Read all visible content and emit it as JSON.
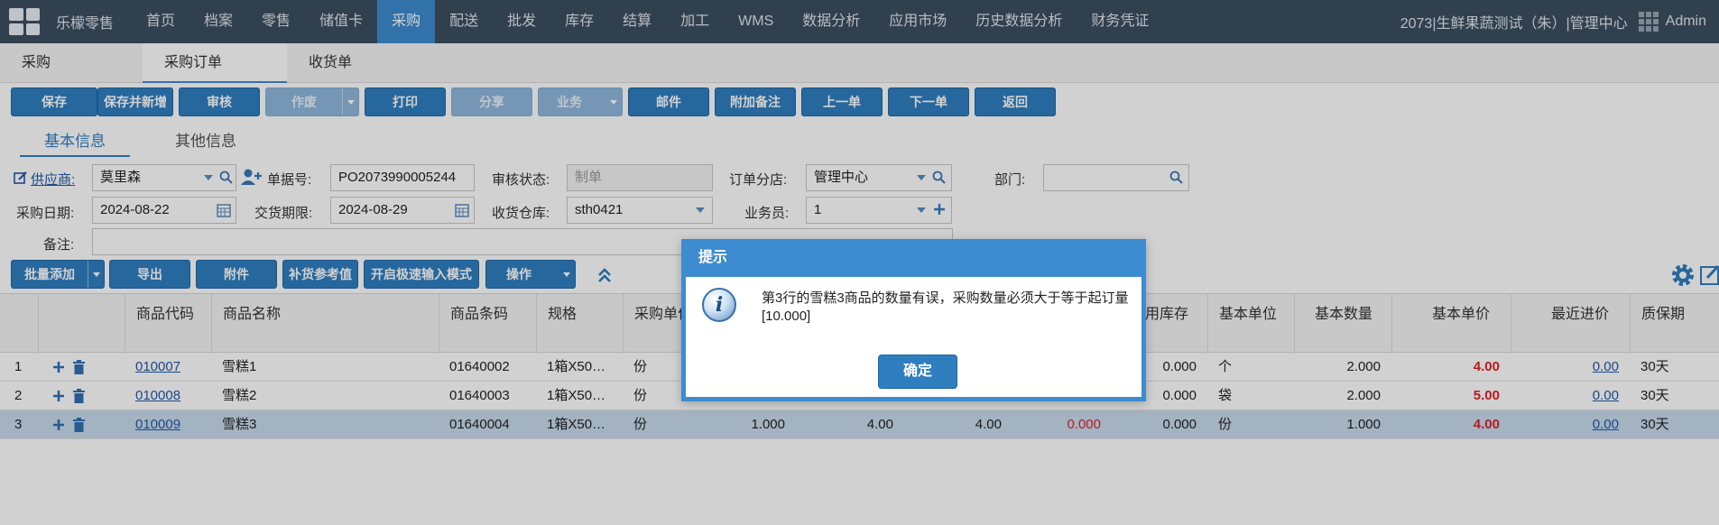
{
  "nav": {
    "brand": "乐檬零售",
    "items": [
      "首页",
      "档案",
      "零售",
      "储值卡",
      "采购",
      "配送",
      "批发",
      "库存",
      "结算",
      "加工",
      "WMS",
      "数据分析",
      "应用市场",
      "历史数据分析",
      "财务凭证"
    ],
    "active_index": 4,
    "store_info": "2073|生鲜果蔬测试（朱）|管理中心",
    "user": "Admin"
  },
  "tabs": [
    {
      "label": "采购"
    },
    {
      "label": "采购订单"
    },
    {
      "label": "收货单"
    }
  ],
  "toolbar": {
    "save": "保存",
    "save_new": "保存并新增",
    "audit": "审核",
    "void": "作废",
    "print": "打印",
    "share": "分享",
    "business": "业务",
    "mail": "邮件",
    "add_note": "附加备注",
    "prev": "上一单",
    "next": "下一单",
    "back": "返回"
  },
  "subtabs": {
    "basic": "基本信息",
    "other": "其他信息"
  },
  "form": {
    "supplier_label": "供应商:",
    "supplier": "莫里森",
    "doc_no_label": "单据号:",
    "doc_no": "PO2073990005244",
    "audit_status_label": "审核状态:",
    "audit_status": "制单",
    "branch_label": "订单分店:",
    "branch": "管理中心",
    "dept_label": "部门:",
    "dept": "",
    "purchase_date_label": "采购日期:",
    "purchase_date": "2024-08-22",
    "delivery_label": "交货期限:",
    "delivery": "2024-08-29",
    "warehouse_label": "收货仓库:",
    "warehouse": "sth0421",
    "salesman_label": "业务员:",
    "salesman": "1",
    "remark_label": "备注:",
    "remark": ""
  },
  "grid_toolbar": {
    "batch_add": "批量添加",
    "export": "导出",
    "attach": "附件",
    "ref_value": "补货参考值",
    "quick_mode": "开启极速输入模式",
    "ops": "操作"
  },
  "columns": {
    "code": "商品代码",
    "name": "商品名称",
    "barcode": "条码",
    "barcode_full": "商品条码",
    "spec": "规格",
    "purchase_unit": "采购单位",
    "usable_stock": "用库存",
    "base_unit": "基本单位",
    "base_qty": "基本数量",
    "base_price": "基本单价",
    "recent_price": "最近进价",
    "shelf_life": "质保期"
  },
  "rows": [
    {
      "no": "1",
      "code": "010007",
      "name": "雪糕1",
      "barcode": "01640002",
      "spec": "1箱X50…",
      "unit": "份",
      "qty": "",
      "price": "",
      "amount": "",
      "gift": "",
      "stock": "0.000",
      "base_unit": "个",
      "base_qty": "2.000",
      "base_price": "4.00",
      "recent": "0.00",
      "shelf": "30天"
    },
    {
      "no": "2",
      "code": "010008",
      "name": "雪糕2",
      "barcode": "01640003",
      "spec": "1箱X50…",
      "unit": "份",
      "qty": "",
      "price": "",
      "amount": "",
      "gift": "",
      "stock": "0.000",
      "base_unit": "袋",
      "base_qty": "2.000",
      "base_price": "5.00",
      "recent": "0.00",
      "shelf": "30天"
    },
    {
      "no": "3",
      "code": "010009",
      "name": "雪糕3",
      "barcode": "01640004",
      "spec": "1箱X50…",
      "unit": "份",
      "qty": "1.000",
      "price": "4.00",
      "amount": "4.00",
      "gift": "0.000",
      "stock": "0.000",
      "base_unit": "份",
      "base_qty": "1.000",
      "base_price": "4.00",
      "recent": "0.00",
      "shelf": "30天"
    }
  ],
  "dialog": {
    "title": "提示",
    "message": "第3行的雪糕3商品的数量有误，采购数量必须大于等于起订量[10.000]",
    "ok": "确定"
  },
  "colors": {
    "nav_bg": "#3c4f61",
    "accent": "#3d8bd0",
    "button": "#2f7ec0",
    "price_red": "#e0202a"
  }
}
